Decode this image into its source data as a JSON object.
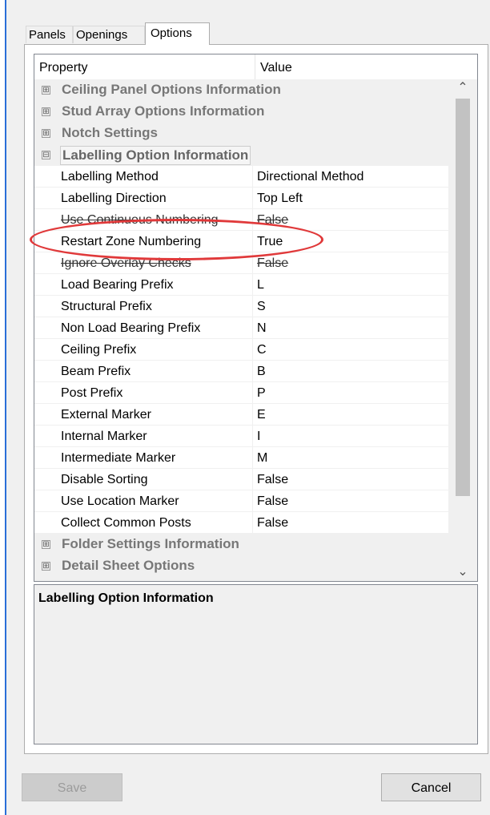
{
  "tabs": [
    {
      "label": "Panels"
    },
    {
      "label": "Openings"
    },
    {
      "label": "Options"
    }
  ],
  "grid": {
    "header": {
      "property": "Property",
      "value": "Value"
    },
    "categories_before": [
      {
        "label": "Ceiling Panel Options Information",
        "expander": "⊞"
      },
      {
        "label": "Stud Array Options Information",
        "expander": "⊞"
      },
      {
        "label": "Notch Settings",
        "expander": "⊞"
      }
    ],
    "expanded_category": {
      "label": "Labelling Option Information",
      "expander": "⊟"
    },
    "properties": [
      {
        "name": "Labelling Method",
        "value": "Directional Method"
      },
      {
        "name": "Labelling Direction",
        "value": "Top Left"
      },
      {
        "name": "Use Continuous Numbering",
        "value": "False"
      },
      {
        "name": "Restart Zone Numbering",
        "value": "True"
      },
      {
        "name": "Ignore Overlay Checks",
        "value": "False"
      },
      {
        "name": "Load Bearing Prefix",
        "value": "L"
      },
      {
        "name": "Structural Prefix",
        "value": "S"
      },
      {
        "name": "Non Load Bearing Prefix",
        "value": "N"
      },
      {
        "name": "Ceiling Prefix",
        "value": "C"
      },
      {
        "name": "Beam Prefix",
        "value": "B"
      },
      {
        "name": "Post Prefix",
        "value": "P"
      },
      {
        "name": "External Marker",
        "value": "E"
      },
      {
        "name": "Internal Marker",
        "value": "I"
      },
      {
        "name": "Intermediate Marker",
        "value": "M"
      },
      {
        "name": "Disable Sorting",
        "value": "False"
      },
      {
        "name": "Use Location Marker",
        "value": "False"
      },
      {
        "name": "Collect Common Posts",
        "value": "False"
      }
    ],
    "categories_after": [
      {
        "label": "Folder Settings Information",
        "expander": "⊞"
      },
      {
        "label": "Detail Sheet Options",
        "expander": "⊞"
      }
    ],
    "scroll_up_icon": "chevron-up-icon",
    "scroll_down_icon": "chevron-down-icon"
  },
  "description": {
    "title": "Labelling Option Information"
  },
  "buttons": {
    "save": "Save",
    "cancel": "Cancel"
  },
  "colors": {
    "annotation": "#e0393a",
    "window_edge": "#2a6fd8"
  }
}
